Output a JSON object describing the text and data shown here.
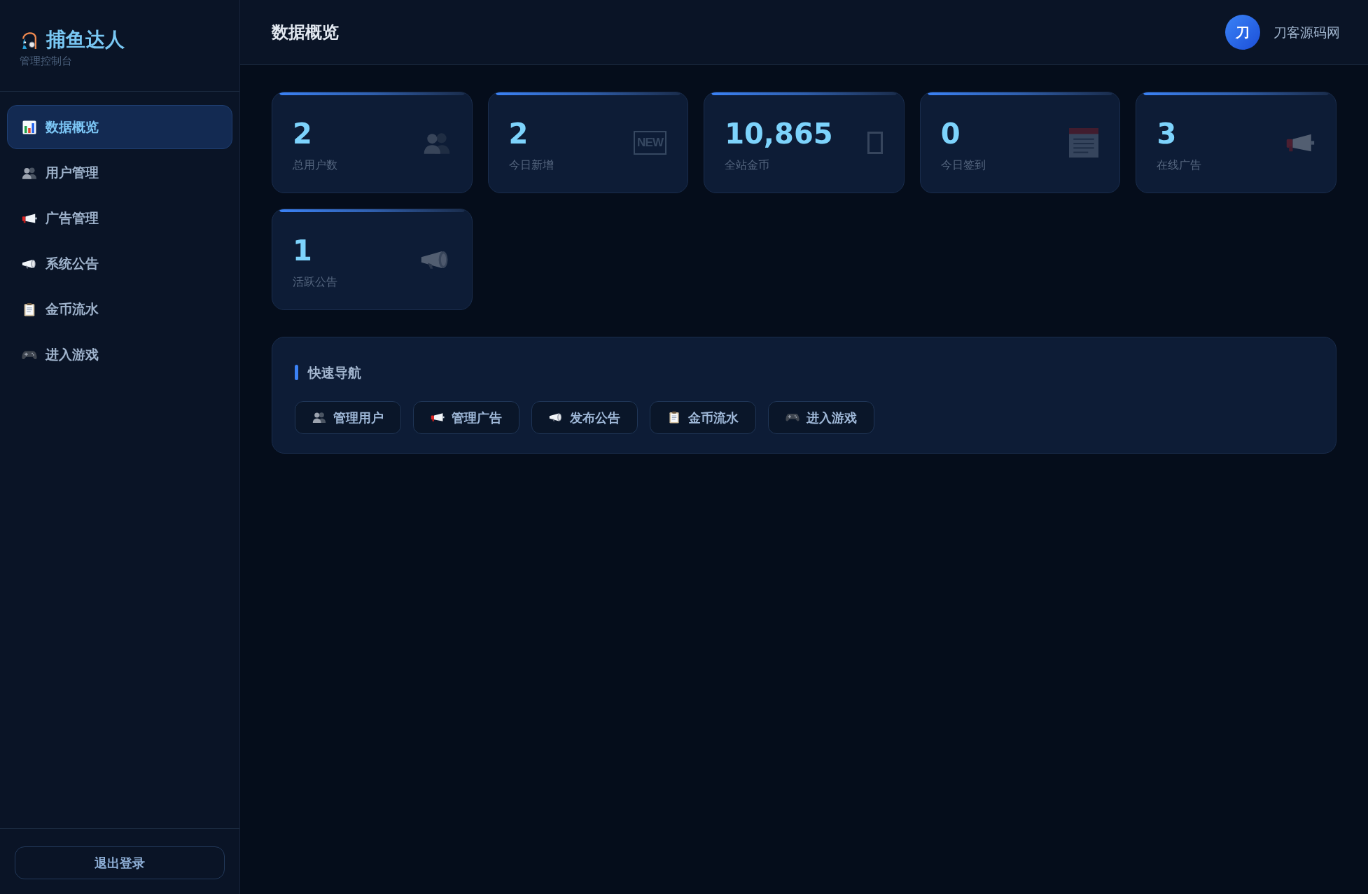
{
  "sidebar": {
    "logo": {
      "title": "捕鱼达人",
      "subtitle": "管理控制台"
    },
    "items": [
      {
        "label": "数据概览",
        "selected": true
      },
      {
        "label": "用户管理",
        "selected": false
      },
      {
        "label": "广告管理",
        "selected": false
      },
      {
        "label": "系统公告",
        "selected": false
      },
      {
        "label": "金币流水",
        "selected": false
      },
      {
        "label": "进入游戏",
        "selected": false
      }
    ],
    "logout_button": "退出登录"
  },
  "header": {
    "title": "数据概览",
    "user": {
      "avatar": "刀",
      "name": "刀客源码网"
    }
  },
  "stats": [
    {
      "value": "2",
      "label": "总用户数"
    },
    {
      "value": "2",
      "label": "今日新增",
      "badge": "NEW"
    },
    {
      "value": "10,865",
      "label": "全站金币"
    },
    {
      "value": "0",
      "label": "今日签到"
    },
    {
      "value": "3",
      "label": "在线广告"
    },
    {
      "value": "1",
      "label": "活跃公告"
    }
  ],
  "quick_nav": {
    "title": "快速导航",
    "buttons": [
      "管理用户",
      "管理广告",
      "发布公告",
      "金币流水",
      "进入游戏"
    ]
  }
}
